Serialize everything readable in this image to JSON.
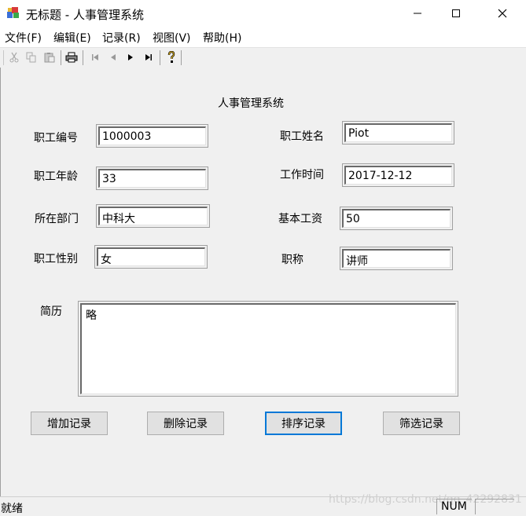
{
  "window": {
    "title": "无标题 - 人事管理系统"
  },
  "menu": [
    "文件(F)",
    "编辑(E)",
    "记录(R)",
    "视图(V)",
    "帮助(H)"
  ],
  "toolbar": {
    "icons": [
      "cut-icon",
      "copy-icon",
      "paste-icon",
      "print-icon",
      "first-record-icon",
      "prev-record-icon",
      "next-record-icon",
      "last-record-icon",
      "help-icon"
    ]
  },
  "form": {
    "heading": "人事管理系统",
    "employee_id": {
      "label": "职工编号",
      "value": "1000003"
    },
    "employee_name": {
      "label": "职工姓名",
      "value": "Piot"
    },
    "age": {
      "label": "职工年龄",
      "value": "33"
    },
    "work_date": {
      "label": "工作时间",
      "value": "2017-12-12"
    },
    "department": {
      "label": "所在部门",
      "value": "中科大"
    },
    "base_salary": {
      "label": "基本工资",
      "value": "50"
    },
    "gender": {
      "label": "职工性别",
      "value": "女"
    },
    "title": {
      "label": "职称",
      "value": "讲师"
    },
    "resume": {
      "label": "简历",
      "value": "略"
    }
  },
  "buttons": {
    "add": "增加记录",
    "delete": "删除记录",
    "sort": "排序记录",
    "filter": "筛选记录"
  },
  "status": {
    "text": "就绪",
    "num": "NUM",
    "watermark": "https://blog.csdn.net/qq_42292831"
  }
}
